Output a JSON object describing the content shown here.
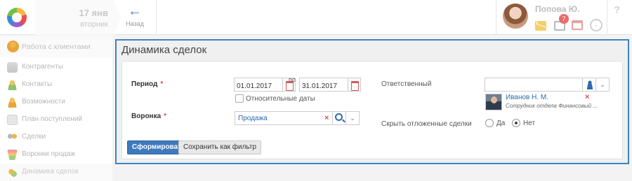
{
  "header": {
    "date_day": "17 янв",
    "date_weekday": "вторник",
    "back_label": "Назад",
    "user_name": "Попова Ю.",
    "tasks_badge": "7",
    "help": "?"
  },
  "sidebar": {
    "section": "Работа с клиентами",
    "items": [
      {
        "label": "Контрагенты"
      },
      {
        "label": "Контакты"
      },
      {
        "label": "Возможности"
      },
      {
        "label": "План поступлений"
      },
      {
        "label": "Сделки"
      },
      {
        "label": "Воронки продаж"
      },
      {
        "label": "Динамика сделок"
      }
    ]
  },
  "panel": {
    "title": "Динамика сделок",
    "period_label": "Период",
    "period_from": "01.01.2017",
    "period_to_label": "по",
    "period_to": "31.01.2017",
    "relative_dates": "Относительные даты",
    "funnel_label": "Воронка",
    "funnel_value": "Продажа",
    "responsible_label": "Ответственный",
    "responsible_value": "",
    "employee_name": "Иванов Н. М.",
    "employee_position": "Сотрудник отдела Финансовый ...",
    "hide_deferred_label": "Скрыть отложенные сделки",
    "option_yes": "Да",
    "option_no": "Нет",
    "hide_deferred_selected": "Нет",
    "submit_label": "Сформировать",
    "save_filter_label": "Сохранить как фильтр",
    "required_mark": "*",
    "remove_mark": "×",
    "chevron": "⌄"
  },
  "colors": {
    "accent": "#3e83c0",
    "primary_button": "#3f79bd",
    "required": "#e04b4b",
    "link": "#2a6cb0"
  }
}
